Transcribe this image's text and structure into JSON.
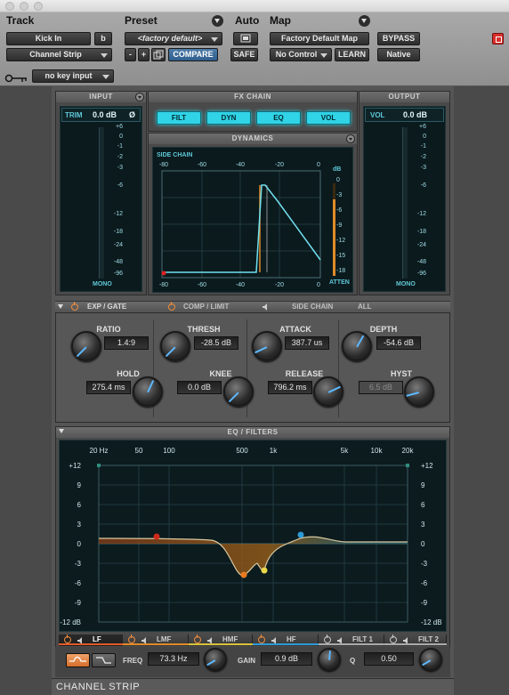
{
  "header": {
    "track_label": "Track",
    "preset_label": "Preset",
    "auto_label": "Auto",
    "map_label": "Map",
    "track_name": "Kick In",
    "track_suffix": "b",
    "plugin_name": "Channel Strip",
    "preset_name": "<factory default>",
    "preset_minus": "-",
    "preset_plus": "+",
    "compare": "COMPARE",
    "safe": "SAFE",
    "map_name": "Factory Default Map",
    "control": "No Control",
    "learn": "LEARN",
    "bypass": "BYPASS",
    "native": "Native",
    "key_input": "no key input"
  },
  "input": {
    "title": "INPUT",
    "trim_label": "TRIM",
    "trim_value": "0.0 dB",
    "phase": "Ø",
    "mono": "MONO",
    "ticks": [
      "+6",
      "0",
      "-1",
      "-2",
      "-3",
      "-6",
      "-12",
      "-18",
      "-24",
      "-48",
      "-96"
    ]
  },
  "output": {
    "title": "OUTPUT",
    "vol_label": "VOL",
    "vol_value": "0.0 dB",
    "mono": "MONO",
    "ticks": [
      "+6",
      "0",
      "-1",
      "-2",
      "-3",
      "-6",
      "-12",
      "-18",
      "-24",
      "-48",
      "-96"
    ]
  },
  "fx_chain": {
    "title": "FX CHAIN",
    "buttons": [
      "FILT",
      "DYN",
      "EQ",
      "VOL"
    ]
  },
  "dynamics": {
    "title": "DYNAMICS",
    "side_chain": "SIDE CHAIN",
    "db_label": "dB",
    "atten_label": "ATTEN",
    "x_ticks": [
      "-80",
      "-60",
      "-40",
      "-20",
      "0"
    ],
    "y_ticks": [
      "0",
      "-3",
      "-6",
      "-9",
      "-12",
      "-15",
      "-18"
    ]
  },
  "dyn_tabs": {
    "exp_gate": "EXP / GATE",
    "comp_limit": "COMP / LIMIT",
    "side_chain": "SIDE CHAIN",
    "all": "ALL"
  },
  "gate_controls": {
    "ratio_label": "RATIO",
    "ratio_value": "1.4:9",
    "thresh_label": "THRESH",
    "thresh_value": "-28.5 dB",
    "attack_label": "ATTACK",
    "attack_value": "387.7 us",
    "depth_label": "DEPTH",
    "depth_value": "-54.6 dB",
    "hold_label": "HOLD",
    "hold_value": "275.4 ms",
    "knee_label": "KNEE",
    "knee_value": "0.0 dB",
    "release_label": "RELEASE",
    "release_value": "796.2 ms",
    "hyst_label": "HYST",
    "hyst_value": "6.5 dB"
  },
  "eq": {
    "title": "EQ / FILTERS",
    "freq_ticks": [
      "20 Hz",
      "50",
      "100",
      "500",
      "1k",
      "5k",
      "10k",
      "20k"
    ],
    "gain_ticks_left": [
      "+12",
      "9",
      "6",
      "3",
      "0",
      "-3",
      "-6",
      "-9",
      "-12 dB"
    ],
    "gain_ticks_right": [
      "+12",
      "9",
      "6",
      "3",
      "0",
      "-3",
      "-6",
      "-9",
      "-12 dB"
    ],
    "bands": [
      "LF",
      "LMF",
      "HMF",
      "HF",
      "FILT 1",
      "FILT 2"
    ],
    "band_colors": [
      "#e05a2a",
      "#e08a2a",
      "#d8c23a",
      "#2e9bd6",
      "#aaaaaa",
      "#aaaaaa"
    ],
    "freq_label": "FREQ",
    "freq_value": "73.3 Hz",
    "gain_label": "GAIN",
    "gain_value": "0.9 dB",
    "q_label": "Q",
    "q_value": "0.50"
  },
  "footer": {
    "title": "CHANNEL STRIP"
  }
}
